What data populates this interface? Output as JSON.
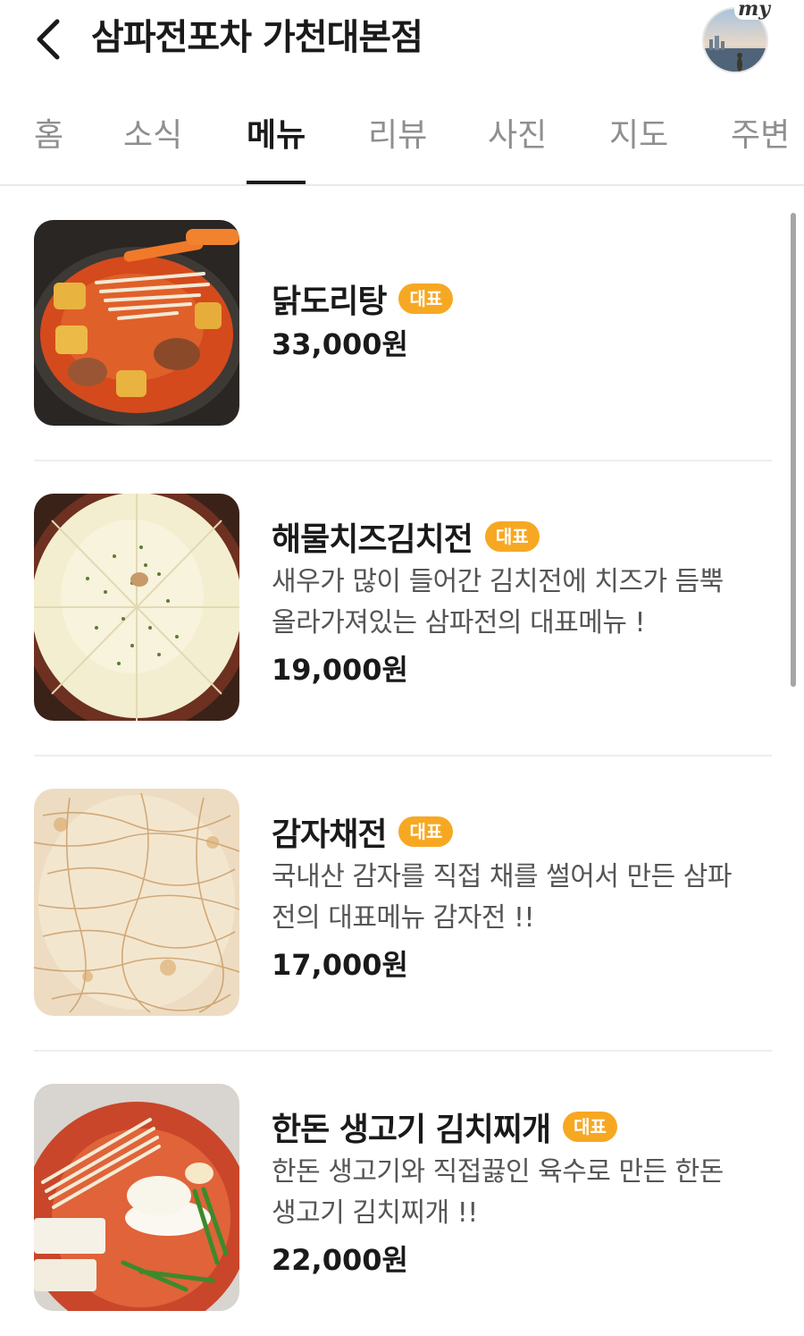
{
  "header": {
    "back_icon": "chevron-left-icon",
    "title": "삼파전포차 가천대본점",
    "avatar_tag": "my"
  },
  "tabs": [
    {
      "label": "홈"
    },
    {
      "label": "소식"
    },
    {
      "label": "메뉴"
    },
    {
      "label": "리뷰"
    },
    {
      "label": "사진"
    },
    {
      "label": "지도"
    },
    {
      "label": "주변"
    }
  ],
  "active_tab": "메뉴",
  "menu": [
    {
      "name": "닭도리탕",
      "badge": "대표",
      "desc_lines": [],
      "price": "33,000원"
    },
    {
      "name": "해물치즈김치전",
      "badge": "대표",
      "desc_lines": [
        "새우가 많이 들어간 김치전에 치즈가 듬뿍",
        "올라가져있는 삼파전의 대표메뉴 !"
      ],
      "price": "19,000원"
    },
    {
      "name": "감자채전",
      "badge": "대표",
      "desc_lines": [
        "국내산 감자를 직접 채를 썰어서 만든 삼파",
        "전의 대표메뉴 감자전 !!"
      ],
      "price": "17,000원"
    },
    {
      "name": "한돈 생고기 김치찌개",
      "badge": "대표",
      "desc_lines": [
        "한돈 생고기와 직접끓인 육수로 만든 한돈",
        "생고기 김치찌개 !!"
      ],
      "price": "22,000원"
    }
  ],
  "colors": {
    "badge": "#f7a823",
    "active_tab": "#1a1a1a",
    "inactive_tab": "#8f8f8f"
  }
}
